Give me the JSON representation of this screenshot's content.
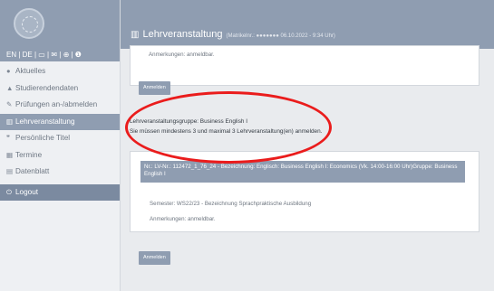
{
  "header": {
    "title": "Lehrveranstaltung",
    "meta": "(Matrikelnr.: ●●●●●●●  06.10.2022 - 9:34 Uhr)",
    "icon": "building-columns-icon"
  },
  "sidebar": {
    "lang_bar": "EN | DE | ▭ | ✉ | ⊕ | ❶",
    "items": [
      {
        "label": "Aktuelles",
        "icon": "chat-bubble-icon"
      },
      {
        "label": "Studierendendaten",
        "icon": "graduation-cap-icon"
      },
      {
        "label": "Prüfungen an-/abmelden",
        "icon": "edit-icon"
      },
      {
        "label": "Lehrveranstaltung",
        "icon": "building-columns-icon",
        "active": true
      },
      {
        "label": "Persönliche Titel",
        "icon": "quote-icon"
      },
      {
        "label": "Termine",
        "icon": "calendar-icon"
      },
      {
        "label": "Datenblatt",
        "icon": "file-icon"
      },
      {
        "label": "Logout",
        "icon": "power-icon"
      }
    ]
  },
  "top_card": {
    "text": "Anmerkungen: anmeldbar.",
    "button": "Anmelden"
  },
  "group": {
    "line1": "Lehrveranstaltungsgruppe: Business English I",
    "line2": "Sie müssen mindestens 3 und maximal 3 Lehrveranstaltung(en) anmelden."
  },
  "course_bar": {
    "text": "Nr.: LV-Nr.: 112472_1_76_24 - Bezeichnung: Englisch: Business English I: Economics (Vk. 14:00-16:00 Uhr)Gruppe: Business English I"
  },
  "course_card": {
    "semester": "Semester: WS22/23 - Bezeichnung Sprachpraktische Ausbildung",
    "notes": "Anmerkungen: anmeldbar.",
    "button": "Anmelden"
  },
  "colors": {
    "accent": "#8f9db1",
    "highlight": "#ea1c1c",
    "background": "#e9ebee"
  }
}
